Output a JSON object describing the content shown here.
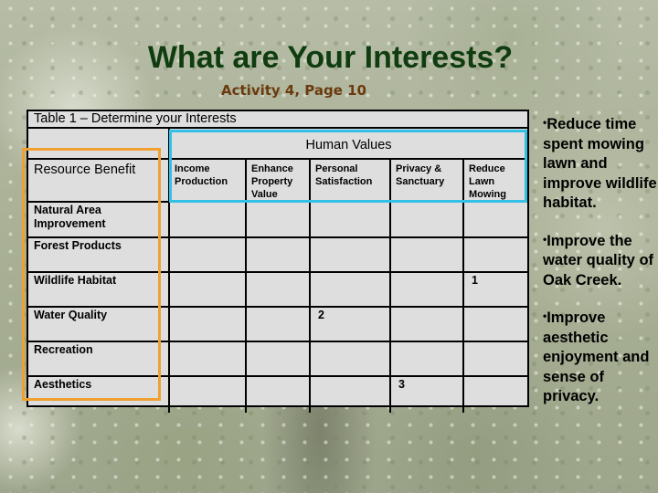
{
  "slide": {
    "title": "What are Your Interests?",
    "subtitle": "Activity 4, Page 10"
  },
  "table": {
    "caption": "Table 1 – Determine your Interests",
    "group_header": "Human Values",
    "row_header_label": "Resource Benefit",
    "columns": [
      "Income Production",
      "Enhance Property Value",
      "Personal Satisfaction",
      "Privacy & Sanctuary",
      "Reduce Lawn Mowing"
    ],
    "rows": [
      {
        "label": "Natural Area Improvement",
        "cells": [
          "",
          "",
          "",
          "",
          ""
        ]
      },
      {
        "label": "Forest Products",
        "cells": [
          "",
          "",
          "",
          "",
          ""
        ]
      },
      {
        "label": "Wildlife Habitat",
        "cells": [
          "",
          "",
          "",
          "",
          "1"
        ]
      },
      {
        "label": "Water Quality",
        "cells": [
          "",
          "",
          "2",
          "",
          ""
        ]
      },
      {
        "label": "Recreation",
        "cells": [
          "",
          "",
          "",
          "",
          ""
        ]
      },
      {
        "label": "Aesthetics",
        "cells": [
          "",
          "",
          "",
          "3",
          ""
        ]
      }
    ],
    "highlight_colors": {
      "resource_benefit_box": "#f0a030",
      "human_values_box": "#33c0e6"
    }
  },
  "goals": [
    {
      "bullet": "•",
      "text": "Reduce time spent mowing lawn and improve wildlife habitat."
    },
    {
      "bullet": "•",
      "text": "Improve the water quality of Oak Creek."
    },
    {
      "bullet": "•",
      "text": "Improve aesthetic enjoyment and sense of privacy."
    }
  ],
  "colors": {
    "title": "#0f3d10",
    "subtitle": "#6b3a0f",
    "table_background": "#dedede"
  }
}
